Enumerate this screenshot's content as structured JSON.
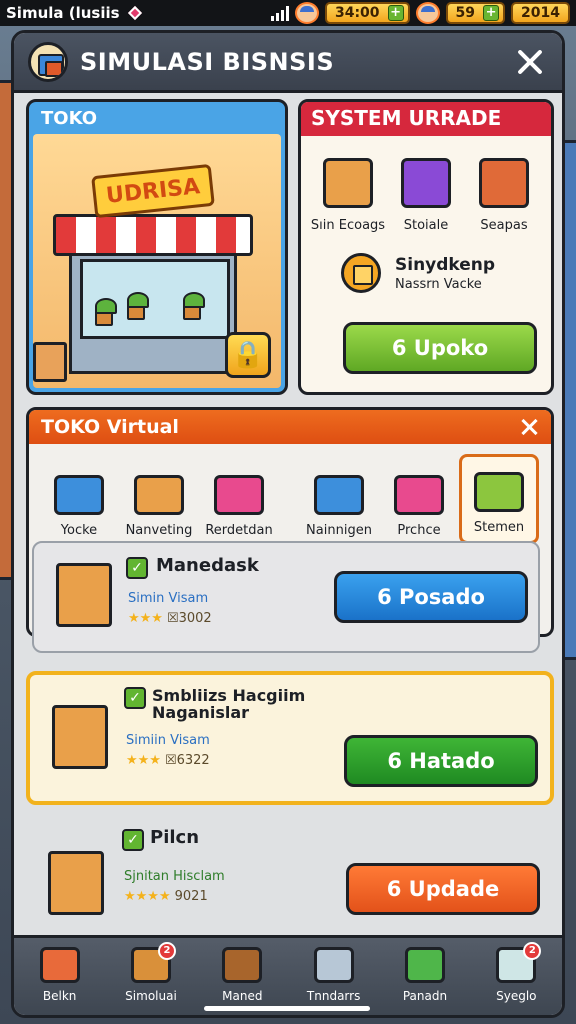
{
  "status_bar": {
    "app_label": "Simula (lusiis",
    "currency_1": "34:00",
    "currency_2": "59",
    "year": "2014",
    "icons": [
      "diamond-icon",
      "signal-icon",
      "avatar-icon",
      "plus-icon"
    ]
  },
  "panel": {
    "title": "SIMULASI BISNSIS"
  },
  "toko": {
    "label": "TOKO",
    "sign_text": "UDRISA",
    "lock_icon": "lock-icon"
  },
  "upgrade": {
    "title": "SYSTEM URRADE",
    "items": [
      {
        "label": "Sıin Ecoags",
        "icon": "box-icon",
        "color": "#e9a04a"
      },
      {
        "label": "Stoiale",
        "icon": "shopping-bag-icon",
        "color": "#8a4ad6"
      },
      {
        "label": "Seapas",
        "icon": "produce-crate-icon",
        "color": "#e06a38"
      }
    ],
    "info_title": "Sinydkenp",
    "info_sub": "Nassrn Vacke",
    "button_label": "6 Upoko"
  },
  "virtual": {
    "title": "TOKO Virtual",
    "categories": [
      {
        "label": "Yocke",
        "icon": "truck-icon",
        "color": "#3d8fdc"
      },
      {
        "label": "Nanveting",
        "icon": "cart-box-icon",
        "color": "#e9a04a"
      },
      {
        "label": "Rerdetdan",
        "icon": "basket-icon",
        "color": "#e84a8e"
      },
      {
        "label": "Nainnigen",
        "icon": "open-box-icon",
        "color": "#3d8fdc"
      },
      {
        "label": "Prchce",
        "icon": "shopping-cart-icon",
        "color": "#e84a8e"
      },
      {
        "label": "Stemen",
        "icon": "produce-box-icon",
        "color": "#8cc63e"
      }
    ],
    "selected_category": "Stemen"
  },
  "products": [
    {
      "name": "Manedask",
      "sub": "Simin Visam",
      "rating_text": "☒3002",
      "stars": 3,
      "button_label": "6 Posado",
      "button_color": "blue",
      "icon": "produce-bag-icon"
    },
    {
      "name": "Smbliizs Hacgiim Naganislar",
      "sub": "Simiin Visam",
      "rating_text": "☒6322",
      "stars": 3,
      "button_label": "6 Hatado",
      "button_color": "green",
      "icon": "shopping-bag-icon"
    },
    {
      "name": "Pilcn",
      "sub": "Sjnitan Hisclam",
      "rating_text": "9021",
      "stars": 4,
      "button_label": "6 Updade",
      "button_color": "orange",
      "icon": "plant-box-icon"
    }
  ],
  "nav": [
    {
      "label": "Belkn",
      "icon": "car-icon",
      "color": "#e86a3a"
    },
    {
      "label": "Simoluai",
      "icon": "crate-icon",
      "color": "#d9903a",
      "badge": "2"
    },
    {
      "label": "Maned",
      "icon": "chest-icon",
      "color": "#a8652c"
    },
    {
      "label": "Tnndarrs",
      "icon": "laptop-icon",
      "color": "#b7c7d6"
    },
    {
      "label": "Panadn",
      "icon": "shop-icon",
      "color": "#4fb64a"
    },
    {
      "label": "Syeglo",
      "icon": "cube-icon",
      "color": "#cfe6e6",
      "badge": "2"
    }
  ]
}
